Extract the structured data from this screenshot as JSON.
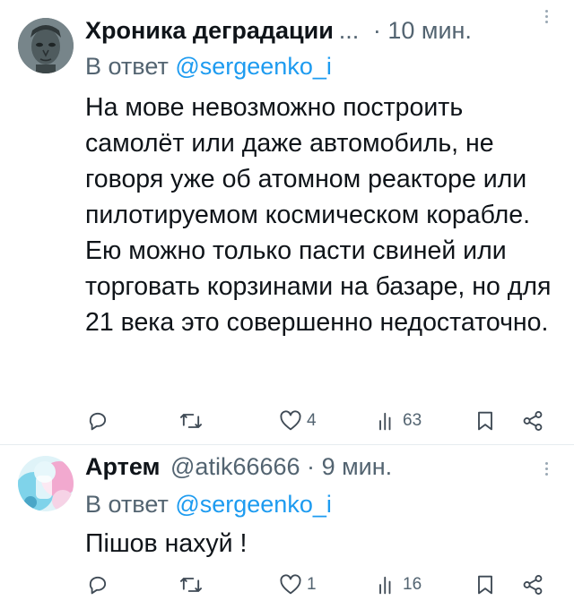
{
  "tweets": [
    {
      "author_name": "Хроника деградации",
      "name_ellipsis": "...",
      "handle": "",
      "separator": "·",
      "time": "10 мин.",
      "reply_prefix": "В ответ",
      "reply_to": "@sergeenko_i",
      "text": "На мове невозможно построить самолёт или даже автомобиль, не говоря уже об атомном реакторе или пилотируемом космическом корабле. Ею можно только пасти свиней или торговать корзинами на базаре, но для 21 века это совершенно недостаточно.",
      "replies": "",
      "retweets": "",
      "likes": "4",
      "views": "63"
    },
    {
      "author_name": "Артем",
      "name_ellipsis": "",
      "handle": "@atik66666",
      "separator": "·",
      "time": "9 мин.",
      "reply_prefix": "В ответ",
      "reply_to": "@sergeenko_i",
      "text": "Пішов нахуй !",
      "replies": "",
      "retweets": "",
      "likes": "1",
      "views": "16"
    }
  ],
  "icons": {
    "reply": "reply-icon",
    "retweet": "retweet-icon",
    "like": "heart-icon",
    "views": "views-icon",
    "bookmark": "bookmark-icon",
    "share": "share-icon",
    "more": "more-icon"
  },
  "colors": {
    "text": "#0f1419",
    "muted": "#536471",
    "link": "#1d9bf0",
    "divider": "#e6ecf0"
  }
}
